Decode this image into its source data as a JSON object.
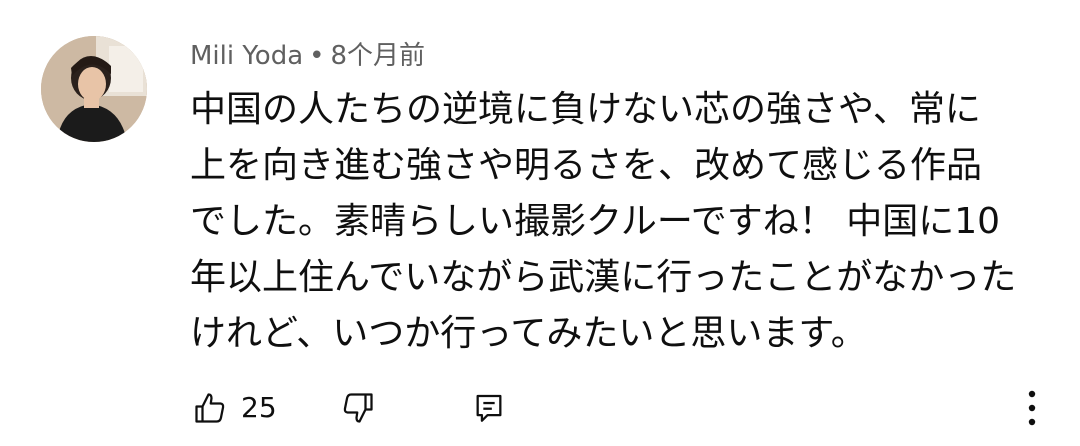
{
  "comment": {
    "author": "Mili Yoda",
    "separator": "•",
    "timestamp": "8个月前",
    "lines": [
      "中国の人たちの逆境に負けない芯の強さや、常に",
      "上を向き進む強さや明るさを、改めて感じる作品",
      "でした。素晴らしい撮影クルーですね！ 中国に10",
      "年以上住んでいながら武漢に行ったことがなかった",
      "けれど、いつか行ってみたいと思います。"
    ]
  },
  "actions": {
    "like_icon": "thumbs-up-icon",
    "like_count": "25",
    "dislike_icon": "thumbs-down-icon",
    "reply_icon": "reply-icon",
    "more_icon": "more-vertical-icon"
  }
}
